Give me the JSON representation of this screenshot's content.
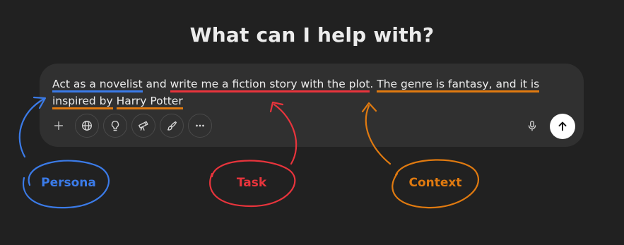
{
  "heading": "What can I help with?",
  "prompt": {
    "persona": "Act as a novelist",
    "join1": " and ",
    "task": "write me a fiction story with the plot",
    "join2": ". ",
    "context_a": "The genre is fantasy, and it is inspired by",
    "join3": " ",
    "context_b": "Harry Potter"
  },
  "toolbar": {
    "icons": [
      "plus-icon",
      "globe-icon",
      "lightbulb-icon",
      "telescope-icon",
      "paint-brush-icon",
      "more-icon"
    ],
    "mic_icon": "microphone-icon",
    "send_icon": "arrow-up-icon"
  },
  "annotations": {
    "persona": "Persona",
    "task": "Task",
    "context": "Context"
  },
  "colors": {
    "background": "#212121",
    "composer": "#303030",
    "persona": "#3b7be8",
    "task": "#e8343c",
    "context": "#e07a10"
  }
}
